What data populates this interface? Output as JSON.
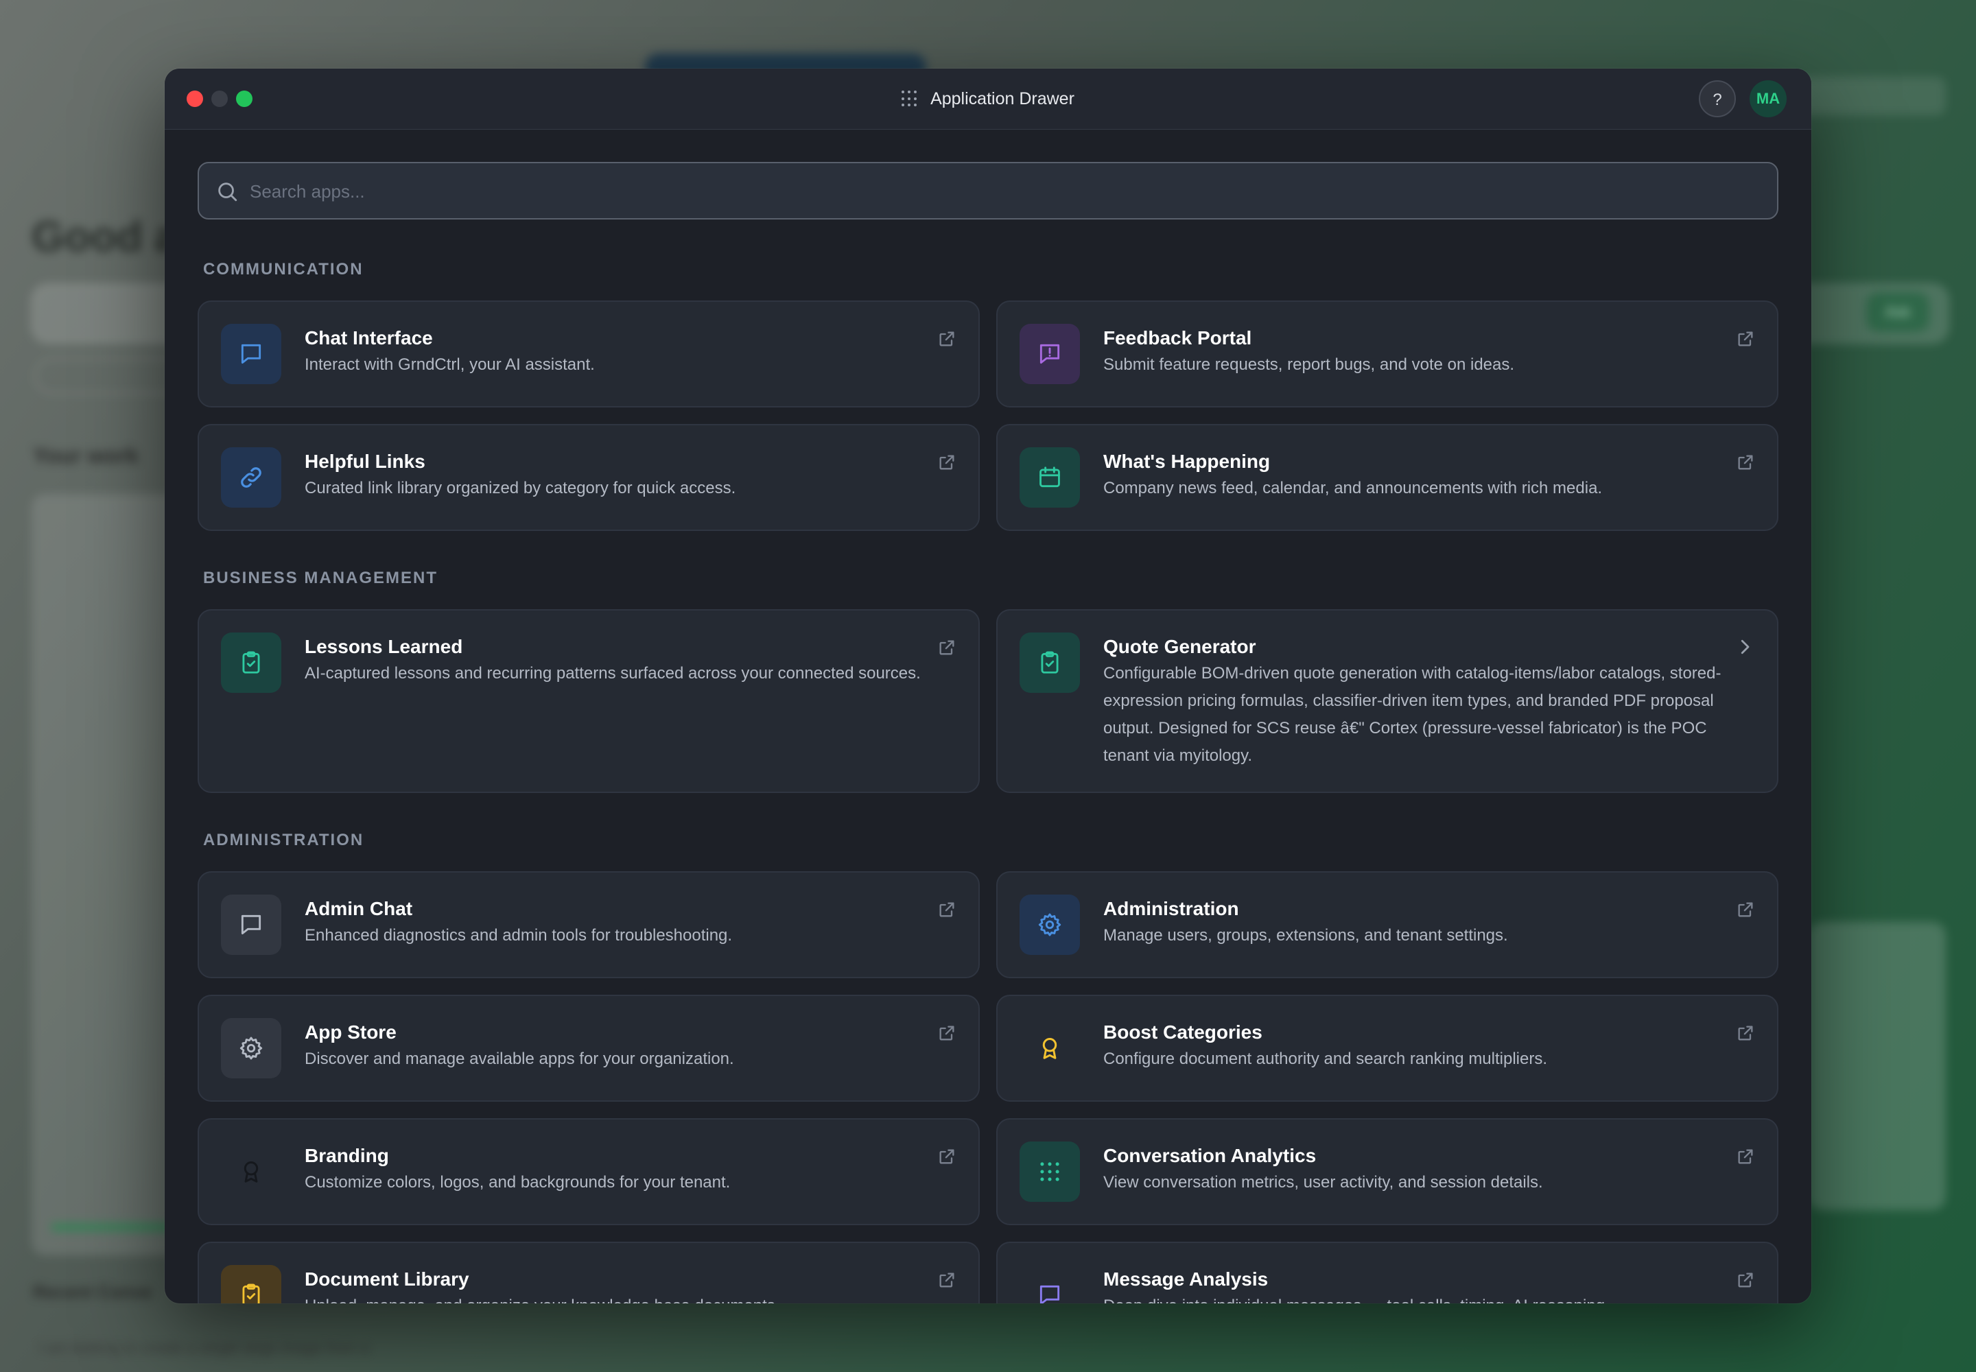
{
  "background": {
    "breadcrumb": "",
    "greeting": "Good a",
    "ask_label": "Ask",
    "your_work": "Your work",
    "recent": "Recent Conve",
    "row_text": "I am looking to create a single large image from a",
    "right_pill": ""
  },
  "window": {
    "title": "Application Drawer",
    "help_label": "?",
    "avatar_initials": "MA"
  },
  "search": {
    "placeholder": "Search apps..."
  },
  "sections": [
    {
      "title": "COMMUNICATION",
      "apps": [
        {
          "name": "Chat Interface",
          "description": "Interact with GrndCtrl, your AI assistant.",
          "icon": "chat-bubble-icon",
          "color": "#4a90e2"
        },
        {
          "name": "Feedback Portal",
          "description": "Submit feature requests, report bugs, and vote on ideas.",
          "icon": "feedback-icon",
          "color": "#a86ae0"
        },
        {
          "name": "Helpful Links",
          "description": "Curated link library organized by category for quick access.",
          "icon": "link-icon",
          "color": "#4a90e2"
        },
        {
          "name": "What's Happening",
          "description": "Company news feed, calendar, and announcements with rich media.",
          "icon": "calendar-icon",
          "color": "#2ec9a0"
        }
      ]
    },
    {
      "title": "BUSINESS MANAGEMENT",
      "apps": [
        {
          "name": "Lessons Learned",
          "description": "AI-captured lessons and recurring patterns surfaced across your connected sources.",
          "icon": "clipboard-check-icon",
          "color": "#2ec9a0"
        },
        {
          "name": "Quote Generator",
          "description": "Configurable BOM-driven quote generation with catalog-items/labor catalogs, stored-expression pricing formulas, classifier-driven item types, and branded PDF proposal output. Designed for SCS reuse â€\" Cortex (pressure-vessel fabricator) is the POC tenant via myitology.",
          "icon": "clipboard-check-icon",
          "color": "#2ec9a0"
        }
      ]
    },
    {
      "title": "ADMINISTRATION",
      "apps": [
        {
          "name": "Admin Chat",
          "description": "Enhanced diagnostics and admin tools for troubleshooting.",
          "icon": "chat-bubble-icon",
          "color": "#b4bac5"
        },
        {
          "name": "Administration",
          "description": "Manage users, groups, extensions, and tenant settings.",
          "icon": "gear-icon",
          "color": "#4a90e2"
        },
        {
          "name": "App Store",
          "description": "Discover and manage available apps for your organization.",
          "icon": "gear-icon",
          "color": "#b4bac5"
        },
        {
          "name": "Boost Categories",
          "description": "Configure document authority and search ranking multipliers.",
          "icon": "award-icon",
          "color": "#f2c230"
        },
        {
          "name": "Branding",
          "description": "Customize colors, logos, and backgrounds for your tenant.",
          "icon": "award-icon",
          "color": "#15181d"
        },
        {
          "name": "Conversation Analytics",
          "description": "View conversation metrics, user activity, and session details.",
          "icon": "dots-grid-icon",
          "color": "#2ec9a0"
        },
        {
          "name": "Document Library",
          "description": "Upload, manage, and organize your knowledge base documents.",
          "icon": "clipboard-check-icon",
          "color": "#f2c230"
        },
        {
          "name": "Message Analysis",
          "description": "Deep dive into individual messages — tool calls, timing, AI reasoning.",
          "icon": "chat-bubble-icon",
          "color": "#8a7cf0"
        }
      ]
    }
  ]
}
